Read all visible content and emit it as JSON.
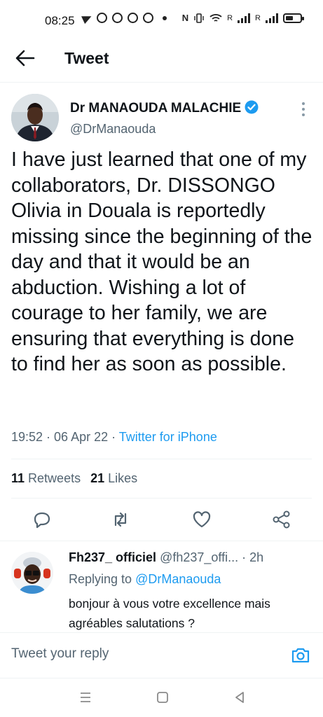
{
  "status_bar": {
    "time": "08:25",
    "net_label_1": "R",
    "net_label_2": "R"
  },
  "header": {
    "back_icon": "arrow-left-icon",
    "title": "Tweet"
  },
  "tweet": {
    "author_name": "Dr MANAOUDA MALACHIE",
    "author_handle": "@DrManaouda",
    "verified_color": "#1d9bf0",
    "text": "I have just learned that one of my collaborators, Dr. DISSONGO Olivia in Douala is reportedly missing since the beginning of the day and that it would be an abduction. Wishing a lot of courage to her family, we are ensuring that everything is done to find her as soon as possible.",
    "time": "19:52",
    "date": "06 Apr 22",
    "source": "Twitter for iPhone",
    "retweets_count": "11",
    "retweets_label": "Retweets",
    "likes_count": "21",
    "likes_label": "Likes"
  },
  "actions": [
    {
      "icon": "reply-icon"
    },
    {
      "icon": "retweet-icon"
    },
    {
      "icon": "like-icon"
    },
    {
      "icon": "share-icon"
    }
  ],
  "reply": {
    "name": "Fh237_ officiel",
    "handle": "@fh237_offi...",
    "age": "· 2h",
    "replying_label": "Replying to",
    "replying_mention": "@DrManaouda",
    "text": "bonjour à vous votre excellence mais agréables salutations ?"
  },
  "compose": {
    "placeholder": "Tweet your reply",
    "camera_icon": "camera-icon"
  },
  "colors": {
    "accent": "#1d9bf0",
    "secondary_text": "#536471",
    "primary_text": "#0f1419"
  }
}
